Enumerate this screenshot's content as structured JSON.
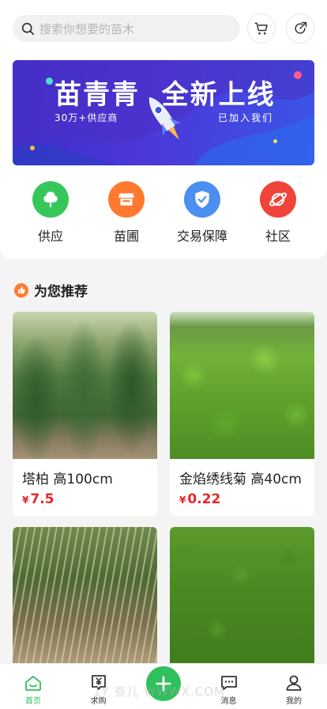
{
  "search": {
    "placeholder": "搜索你想要的苗木"
  },
  "header_icons": [
    "cart-icon",
    "share-icon"
  ],
  "banner": {
    "title": "苗青青  全新上线",
    "subtitle_left": "30万+供应商",
    "subtitle_right": "已加入我们"
  },
  "categories": [
    {
      "label": "供应",
      "icon": "tree-icon",
      "color": "#35c759"
    },
    {
      "label": "苗圃",
      "icon": "store-icon",
      "color": "#ff7a2f"
    },
    {
      "label": "交易保障",
      "icon": "shield-icon",
      "color": "#4b8ff0"
    },
    {
      "label": "社区",
      "icon": "planet-icon",
      "color": "#f0443a"
    }
  ],
  "recommend": {
    "title": "为您推荐"
  },
  "products": [
    {
      "name": "塔柏 高100cm",
      "currency": "¥",
      "price": "7.5"
    },
    {
      "name": "金焰绣线菊 高40cm",
      "currency": "¥",
      "price": "0.22"
    },
    {
      "name": "",
      "currency": "",
      "price": ""
    },
    {
      "name": "",
      "currency": "",
      "price": ""
    }
  ],
  "tabbar": {
    "items": [
      {
        "label": "首页",
        "icon": "home-icon",
        "active": true
      },
      {
        "label": "求购",
        "icon": "purchase-icon",
        "active": false
      },
      {
        "label": "",
        "icon": "plus-icon",
        "active": false
      },
      {
        "label": "消息",
        "icon": "message-icon",
        "active": false
      },
      {
        "label": "我的",
        "icon": "user-icon",
        "active": false
      }
    ]
  },
  "watermark": "1Y 查儿 WWWX.COM",
  "colors": {
    "accent": "#2fbf5c",
    "price": "#e8262a"
  }
}
